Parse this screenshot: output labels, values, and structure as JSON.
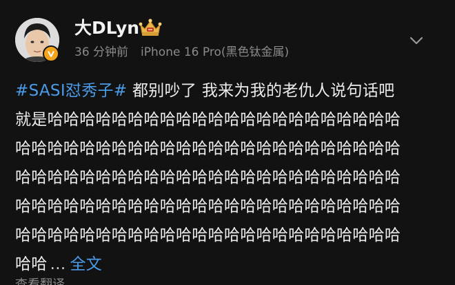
{
  "post": {
    "author": {
      "name": "大DLyn",
      "avatar_icon": "user-avatar-photo",
      "verified_icon": "verified-v-icon",
      "verified_color": "#f4a51c",
      "badge_icon": "golden-crown-icon"
    },
    "meta": {
      "time": "36 分钟前",
      "device": "iPhone 16 Pro(黑色钛金属)"
    },
    "menu_icon": "chevron-down-icon",
    "content": {
      "hashtag": "#SASI怼秀子#",
      "first_line_text": " 都别吵了 我来为我的老仇人说句话吧",
      "lines": [
        "就是哈哈哈哈哈哈哈哈哈哈哈哈哈哈哈哈哈哈哈哈哈哈",
        "哈哈哈哈哈哈哈哈哈哈哈哈哈哈哈哈哈哈哈哈哈哈哈哈",
        "哈哈哈哈哈哈哈哈哈哈哈哈哈哈哈哈哈哈哈哈哈哈哈哈",
        "哈哈哈哈哈哈哈哈哈哈哈哈哈哈哈哈哈哈哈哈哈哈哈哈",
        "哈哈哈哈哈哈哈哈哈哈哈哈哈哈哈哈哈哈哈哈哈哈哈哈"
      ],
      "last_line_text": "哈哈",
      "ellipsis": "...",
      "expand_label": "全文"
    },
    "translate_label": "查看翻译"
  },
  "colors": {
    "background": "#121212",
    "link": "#4a9be8",
    "meta_text": "#8a8a8a"
  }
}
